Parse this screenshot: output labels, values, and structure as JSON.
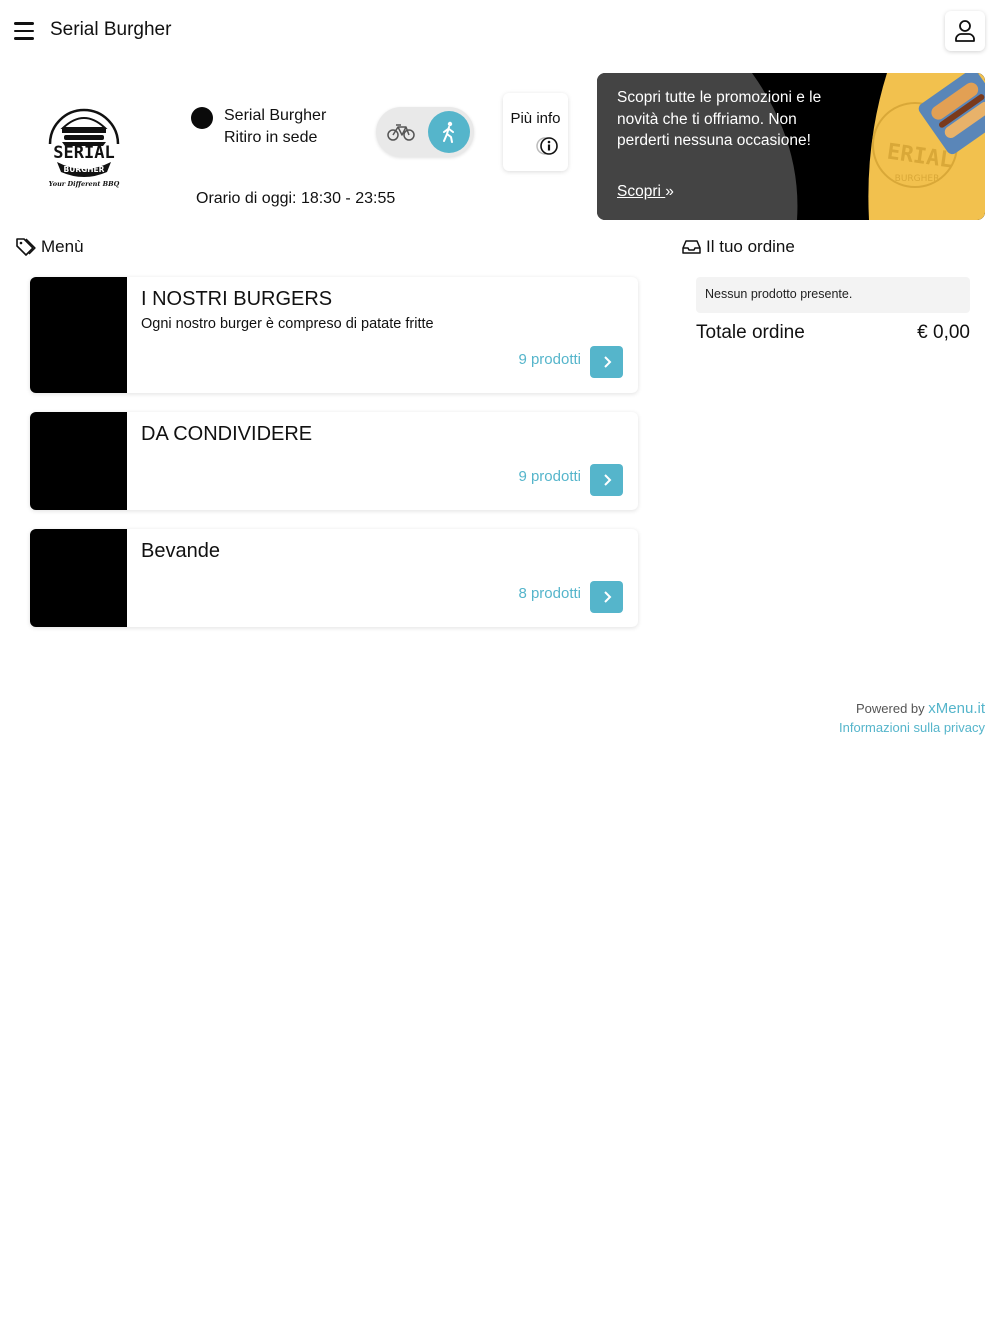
{
  "header": {
    "title": "Serial Burgher"
  },
  "store": {
    "logo_text": "SERIAL",
    "logo_sub": "BURGHER",
    "logo_tagline": "Your Different BBQ",
    "name": "Serial Burgher",
    "mode": "Ritiro in sede",
    "hours": "Orario di oggi: 18:30 - 23:55",
    "info_label": "Più info"
  },
  "promo": {
    "text": "Scopri tutte le promozioni e le novità che ti offriamo. Non perderti nessuna occasione!",
    "link": "Scopri"
  },
  "menu": {
    "heading": "Menù",
    "categories": [
      {
        "title": "I NOSTRI BURGERS",
        "description": "Ogni nostro burger è compreso di patate fritte",
        "count": "9 prodotti"
      },
      {
        "title": "DA CONDIVIDERE",
        "description": "",
        "count": "9 prodotti"
      },
      {
        "title": "Bevande",
        "description": "",
        "count": "8 prodotti"
      }
    ]
  },
  "order": {
    "heading": "Il tuo ordine",
    "empty": "Nessun prodotto presente.",
    "total_label": "Totale ordine",
    "total_value": "€ 0,00"
  },
  "footer": {
    "powered_by": "Powered by",
    "brand": "xMenu.it",
    "privacy": "Informazioni sulla privacy"
  },
  "colors": {
    "accent": "#55b5cb",
    "promo_dark": "#444444",
    "promo_yellow": "#f2c14e"
  }
}
